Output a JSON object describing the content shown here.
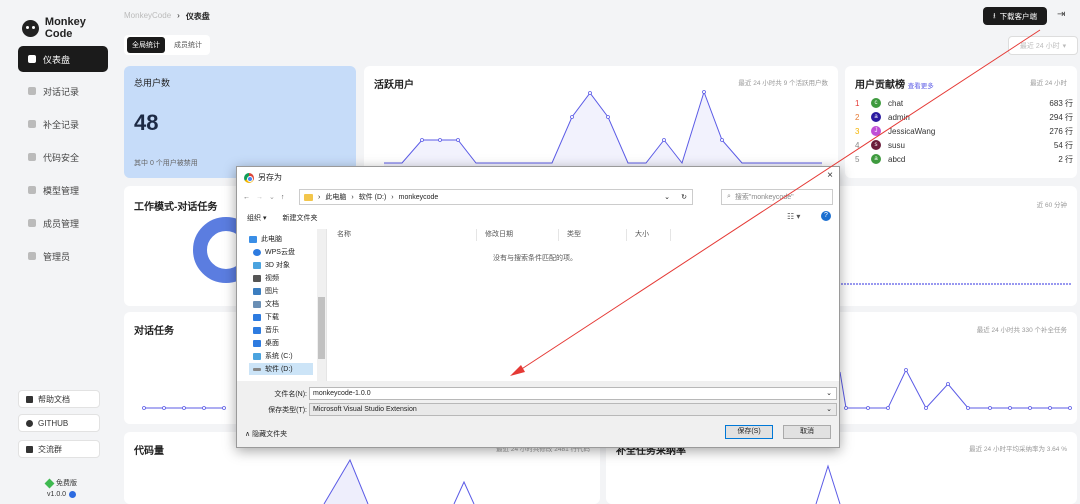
{
  "app": {
    "logo_text": "Monkey Code",
    "version": "v1.0.0"
  },
  "sidebar": {
    "items": [
      {
        "label": "仪表盘",
        "active": true
      },
      {
        "label": "对话记录"
      },
      {
        "label": "补全记录"
      },
      {
        "label": "代码安全"
      },
      {
        "label": "模型管理"
      },
      {
        "label": "成员管理"
      },
      {
        "label": "管理员"
      }
    ],
    "bottom": [
      "帮助文档",
      "GITHUB",
      "交流群"
    ],
    "plan": "免费版"
  },
  "header": {
    "breadcrumb_root": "MonkeyCode",
    "breadcrumb_sep": "›",
    "breadcrumb_current": "仪表盘",
    "download_label": "下载客户端",
    "time_range": "最近 24 小时"
  },
  "tabs": [
    "全局统计",
    "成员统计"
  ],
  "cards": {
    "total_users": {
      "title": "总用户数",
      "value": "48",
      "note": "其中 0 个用户被禁用"
    },
    "active_users": {
      "title": "活跃用户",
      "sub": "最近 24 小时共 9 个活跃用户数"
    },
    "contrib": {
      "title": "用户贡献榜",
      "link": "查看更多",
      "sub": "最近 24 小时",
      "rows": [
        {
          "rank": "1",
          "initial": "c",
          "name": "chat",
          "value": "683 行",
          "color": "#3f9b3f"
        },
        {
          "rank": "2",
          "initial": "a",
          "name": "admin",
          "value": "294 行",
          "color": "#2b1aa0"
        },
        {
          "rank": "3",
          "initial": "J",
          "name": "JessicaWang",
          "value": "276 行",
          "color": "#c04fd6"
        },
        {
          "rank": "4",
          "initial": "s",
          "name": "susu",
          "value": "54 行",
          "color": "#6b1d3a"
        },
        {
          "rank": "5",
          "initial": "a",
          "name": "abcd",
          "value": "2 行",
          "color": "#3f9b3f"
        }
      ]
    },
    "work_mode": {
      "title": "工作模式-对话任务"
    },
    "right_mid": {
      "sub": "近 60 分钟"
    },
    "chat_tasks": {
      "title": "对话任务"
    },
    "completion_tasks": {
      "sub": "最近 24 小时共 330 个补全任务"
    },
    "code_lines": {
      "title": "代码量",
      "sub": "最近 24 小时共修改 2481 行代码"
    },
    "accept_rate": {
      "title": "补全任务采纳率",
      "sub": "最近 24 小时平均采纳率为 3.64 %"
    }
  },
  "dialog": {
    "title": "另存为",
    "close": "×",
    "path": [
      "此电脑",
      "软件 (D:)",
      "monkeycode"
    ],
    "search_placeholder": "搜索\"monkeycode\"",
    "toolbar": [
      "组织 ▾",
      "新建文件夹"
    ],
    "tree": [
      {
        "label": "此电脑",
        "color": "#3a8ee6"
      },
      {
        "label": "WPS云盘",
        "color": "#2d7be0"
      },
      {
        "label": "3D 对象",
        "color": "#4aa3df"
      },
      {
        "label": "视频",
        "color": "#555"
      },
      {
        "label": "图片",
        "color": "#3b7dbf"
      },
      {
        "label": "文档",
        "color": "#6a8fb5"
      },
      {
        "label": "下载",
        "color": "#2d7be0"
      },
      {
        "label": "音乐",
        "color": "#2d7be0"
      },
      {
        "label": "桌面",
        "color": "#2d7be0"
      },
      {
        "label": "系统 (C:)",
        "color": "#4aa3df"
      },
      {
        "label": "软件 (D:)",
        "color": "#888",
        "selected": true
      }
    ],
    "columns": [
      "名称",
      "修改日期",
      "类型",
      "大小"
    ],
    "empty_message": "没有与搜索条件匹配的项。",
    "filename_label": "文件名(N):",
    "filename_value": "monkeycode-1.0.0",
    "filetype_label": "保存类型(T):",
    "filetype_value": "Microsoft Visual Studio Extension",
    "hide_folders": "隐藏文件夹",
    "save_label": "保存(S)",
    "cancel_label": "取消"
  },
  "colors": {
    "accent": "#5b5be6",
    "annotation": "#e53935",
    "dark": "#1b1b1b"
  }
}
